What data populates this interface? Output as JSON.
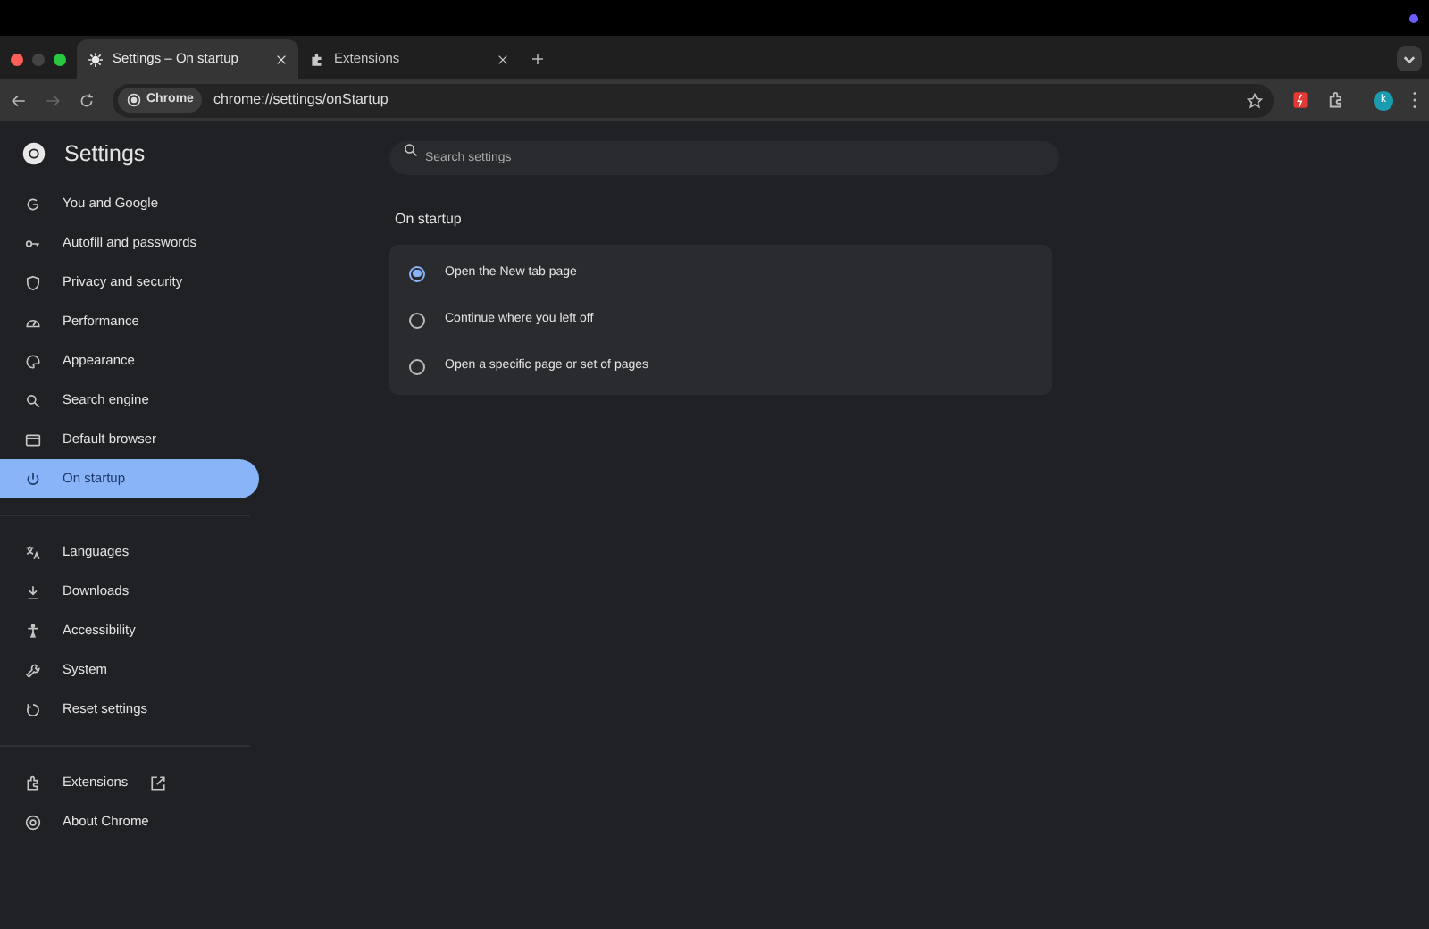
{
  "tabs": [
    {
      "title": "Settings – On startup",
      "selected": true
    },
    {
      "title": "Extensions",
      "selected": false
    }
  ],
  "toolbar": {
    "chip": "Chrome",
    "url": "chrome://settings/onStartup",
    "avatar": "k"
  },
  "sidebar": {
    "title": "Settings",
    "groups": [
      {
        "items": [
          {
            "label": "You and Google",
            "selected": false,
            "external": false
          },
          {
            "label": "Autofill and passwords",
            "selected": false,
            "external": false
          },
          {
            "label": "Privacy and security",
            "selected": false,
            "external": false
          },
          {
            "label": "Performance",
            "selected": false,
            "external": false
          },
          {
            "label": "Appearance",
            "selected": false,
            "external": false
          },
          {
            "label": "Search engine",
            "selected": false,
            "external": false
          },
          {
            "label": "Default browser",
            "selected": false,
            "external": false
          },
          {
            "label": "On startup",
            "selected": true,
            "external": false
          }
        ]
      },
      {
        "items": [
          {
            "label": "Languages",
            "selected": false,
            "external": false
          },
          {
            "label": "Downloads",
            "selected": false,
            "external": false
          },
          {
            "label": "Accessibility",
            "selected": false,
            "external": false
          },
          {
            "label": "System",
            "selected": false,
            "external": false
          },
          {
            "label": "Reset settings",
            "selected": false,
            "external": false
          }
        ]
      },
      {
        "items": [
          {
            "label": "Extensions",
            "selected": false,
            "external": true
          },
          {
            "label": "About Chrome",
            "selected": false,
            "external": false
          }
        ]
      }
    ]
  },
  "search": {
    "placeholder": "Search settings"
  },
  "section": {
    "title": "On startup",
    "options": [
      {
        "label": "Open the New tab page",
        "selected": true
      },
      {
        "label": "Continue where you left off",
        "selected": false
      },
      {
        "label": "Open a specific page or set of pages",
        "selected": false
      }
    ]
  }
}
